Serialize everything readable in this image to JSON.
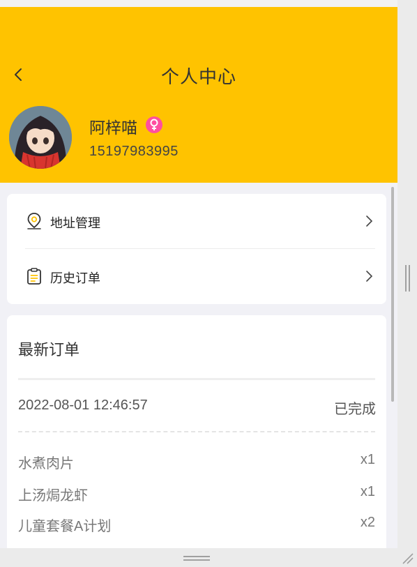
{
  "header": {
    "title": "个人中心",
    "username": "阿梓喵",
    "phone": "15197983995",
    "gender_icon": "female-icon",
    "back_icon": "chevron-left-icon"
  },
  "menu": {
    "items": [
      {
        "label": "地址管理",
        "icon": "location-pin-icon"
      },
      {
        "label": "历史订单",
        "icon": "clipboard-icon"
      }
    ]
  },
  "latest_order": {
    "title": "最新订单",
    "datetime": "2022-08-01 12:46:57",
    "status": "已完成",
    "items": [
      {
        "name": "水煮肉片",
        "qty": "x1"
      },
      {
        "name": "上汤焗龙虾",
        "qty": "x1"
      },
      {
        "name": "儿童套餐A计划",
        "qty": "x2"
      }
    ]
  },
  "colors": {
    "header_bg": "#ffc300",
    "page_bg": "#f1f1f6",
    "gender_badge": "#ff4fa0"
  }
}
